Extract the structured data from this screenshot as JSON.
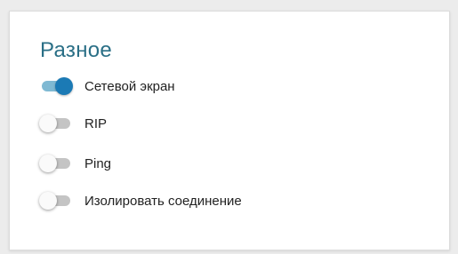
{
  "section": {
    "title": "Разное",
    "title_color": "#2a6f86",
    "accent_color": "#1b7ab5"
  },
  "toggles": [
    {
      "label": "Сетевой экран",
      "enabled": true
    },
    {
      "label": "RIP",
      "enabled": false
    },
    {
      "label": "Ping",
      "enabled": false
    },
    {
      "label": "Изолировать соединение",
      "enabled": false
    }
  ]
}
